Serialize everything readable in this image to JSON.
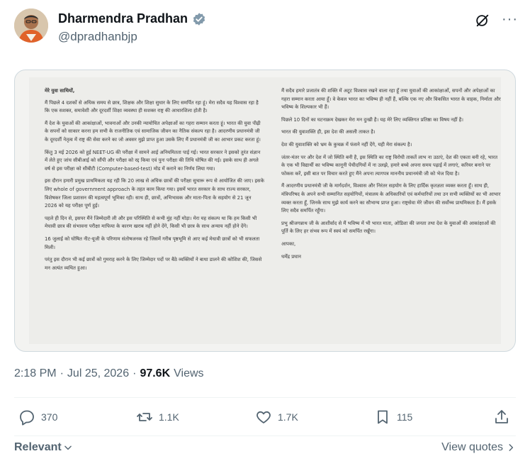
{
  "author": {
    "name": "Dharmendra Pradhan",
    "handle": "@dpradhanbjp",
    "verified_color": "#829aab"
  },
  "header_icons": [
    "grok-icon",
    "more-icon"
  ],
  "header_more": "···",
  "letter": {
    "greeting": "मेरे युवा साथियों,",
    "left": [
      "मैं पिछले 4 दशकों से अधिक समय से छात्र, शिक्षक और शिक्षा सुधार के लिए समर्पित रहा हूं। मेरा सदैव यह विश्वास रहा है कि एक सशक्त, समावेशी और दूरदर्शी शिक्षा व्यवस्था ही सशक्त राष्ट्र की आधारशिला होती है।",
      "मैं देश के युवाओं की आकांक्षाओं, भावनाओं और उनकी न्यायोचित अपेक्षाओं का गहरा सम्मान करता हूं। भारत की युवा पीढ़ी के सपनों को साकार करना हम सभी के राजनीतिक एवं सामाजिक जीवन का नैतिक संकल्प रहा है। आदरणीय प्रधानमंत्री जी के दूरदर्शी नेतृत्व में राष्ट्र की सेवा करने का जो अवसर मुझे प्राप्त हुआ उसके लिए मैं प्रधानमंत्री जी का आभार प्रकट करता हूं।",
      "किंतु 3 मई 2026 को हुई NEET-UG की परीक्षा में सामने आई अनियमितता पाई गई। भारत सरकार ने इसको तुरंत संज्ञान में लेते हुए जांच सीबीआई को सौंपी और परीक्षा को रद्द किया एवं पुनः परीक्षा की तिथि घोषित की गई। इसके साथ ही अगले वर्ष से इस परीक्षा को सीबीटी (Computer-based-test) मोड में कराने का निर्णय लिया गया।",
      "इस दौरान हमारी प्रमुख प्राथमिकता यह रही कि 20 लाख से अधिक छात्रों की परीक्षा सुचारू रूप से आयोजित की जाए। इसके लिए whole of government approach के तहत काम किया गया। इसमें भारत सरकार के साथ राज्य सरकार, विशेषकर जिला प्रशासन की महत्वपूर्ण भूमिका रही। साथ ही, छात्रों, अभिभावक और माता-पिता के सहयोग से 21 जून 2026 को यह परीक्षा पूर्ण हुई।",
      "पहले ही दिन से, इसपर मैंने जिम्मेदारी ली और इस परिस्थिति से कभी मुंह नहीं मोड़ा। मेरा यह संकल्प था कि हम किसी भी मेधावी छात्र की संभावना परीक्षा माफिया के कारण खराब नहीं होने देंगे, किसी भी छात्र के साथ अन्याय नहीं होने देंगे।",
      "16 जुलाई को घोषित नीट-यूजी के परिणाम संतोषजनक रहे जिसमें गरीब पृष्ठभूमि से आए कई मेधावी छात्रों को भी सफलता मिली।",
      "परंतु इस दौरान भी कई छात्रों को गुमराह करने के लिए जिम्मेदार पदों पर बैठे व्यक्तियों ने बाधा डालने की कोशिश की, जिससे मन अत्यंत व्यथित हुआ।"
    ],
    "right": [
      "मैं सदैव हमारे प्रजातंत्र की शक्ति में अटूट विश्वास रखने वाला रहा हूँ तथा युवाओं की आकांक्षाओं, सपनों और अपेक्षाओं का गहरा सम्मान करता आया हूँ। वे केवल भारत का भविष्य ही नहीं हैं, बल्कि एक नए और विकसित भारत के वाहक, निर्माता और भविष्य के शिल्पकार भी हैं।",
      "पिछले 10 दिनों का घटनाक्रम देखकर मेरा मन दुःखी है। यह मेरे लिए व्यक्तिगत प्रतिष्ठा का विषय नहीं है।",
      "भारत की युवाशक्ति ही, इस देश की असली ताकत है।",
      "देश की युवाशक्ति को भ्रम के कुचक्र में फंसने नहीं देंगे, यही मेरा संकल्प है।",
      "जंतर-मंतर पर और देश में जो स्थिति बनी है, इस स्थिति का राष्ट्र विरोधी ताकतें लाभ ना उठाएं, देश की एकता बनी रहे, भारत के एक भी विद्यार्थी का भविष्य कानूनी पेचीदगियों में ना उलझे, हमारे बच्चे अपना समय पढ़ाई में लगाएं, करियर बनाने पर फोकस करें, इसी बात पर विचार करते हुए मैंने अपना त्यागपत्र माननीय प्रधानमंत्री जी को भेज दिया है।",
      "मैं आदरणीय प्रधानमंत्री जी के मार्गदर्शन, विश्वास और निरंतर सहयोग के लिए हार्दिक कृतज्ञता व्यक्त करता हूँ। साथ ही, मंत्रिपरिषद के अपने सभी सम्मानित सहयोगियों, मंत्रालय के अधिकारियों एवं कर्मचारियों तथा उन सभी व्यक्तियों का भी आभार व्यक्त करता हूँ, जिनके साथ मुझे कार्य करने का सौभाग्य प्राप्त हुआ। राष्ट्रसेवा मेरे जीवन की सर्वोच्च प्राथमिकता है। मैं इसके लिए सदैव समर्पित रहूँगा।",
      "प्रभु श्रीजगन्नाथ जी के आशीर्वाद से मैं भविष्य में भी भारत माता, ओडिशा की जनता तथा देश के युवाओं की आकांक्षाओं की पूर्ति के लिए हर संभव रूप में स्वयं को समर्पित रखूँगा।",
      "आपका,",
      "धर्मेंद्र प्रधान"
    ]
  },
  "meta": {
    "time": "2:18 PM",
    "separator": "·",
    "date": "Jul 25, 2026",
    "views_count": "97.6K",
    "views_label": "Views"
  },
  "actions": {
    "replies": "370",
    "reposts": "1.1K",
    "likes": "1.7K",
    "bookmarks": "115"
  },
  "footer": {
    "sort_label": "Relevant",
    "view_quotes": "View quotes"
  }
}
